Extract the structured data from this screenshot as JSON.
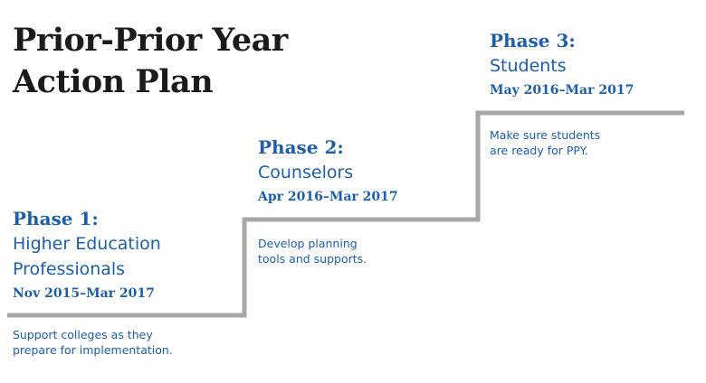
{
  "title": {
    "line1": "Prior-Prior Year",
    "line2": "Action Plan"
  },
  "colors": {
    "accent": "#1e5ea7",
    "title": "#1b1b1b",
    "step": "#a7a7a7"
  },
  "phases": [
    {
      "number": "Phase 1:",
      "name_lines": [
        "Higher Education",
        "Professionals"
      ],
      "dates": "Nov 2015–Mar 2017",
      "description_lines": [
        "Support colleges as they",
        "prepare for implementation."
      ]
    },
    {
      "number": "Phase 2:",
      "name_lines": [
        "Counselors"
      ],
      "dates": "Apr 2016–Mar 2017",
      "description_lines": [
        "Develop planning",
        "tools and supports."
      ]
    },
    {
      "number": "Phase 3:",
      "name_lines": [
        "Students"
      ],
      "dates": "May 2016–Mar 2017",
      "description_lines": [
        "Make sure students",
        "are ready for PPY."
      ]
    }
  ]
}
